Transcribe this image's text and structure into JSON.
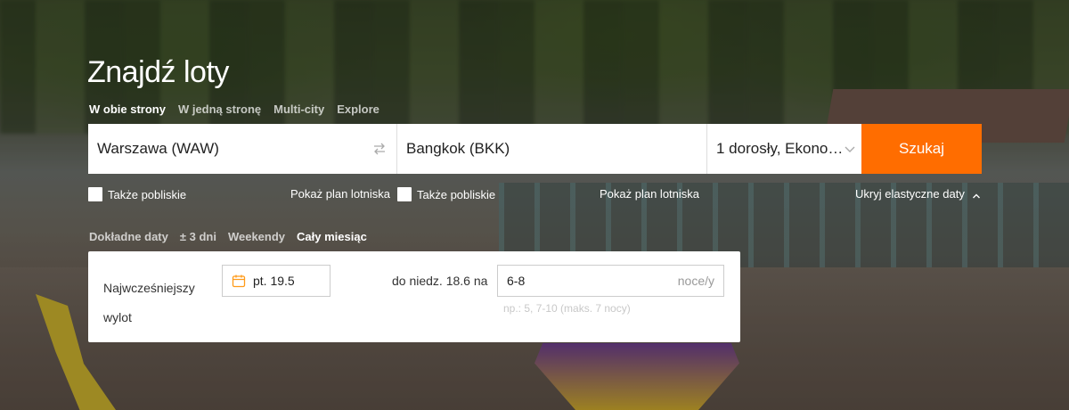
{
  "page": {
    "title": "Znajdź loty"
  },
  "trip_types": [
    "W obie strony",
    "W jedną stronę",
    "Multi-city",
    "Explore"
  ],
  "search": {
    "origin": "Warszawa (WAW)",
    "destination": "Bangkok (BKK)",
    "passengers": "1 dorosły, Ekono…",
    "button": "Szukaj"
  },
  "options": {
    "nearby_origin": "Także pobliskie",
    "airport_map_origin": "Pokaż plan lotniska",
    "nearby_dest": "Także pobliskie",
    "airport_map_dest": "Pokaż plan lotniska",
    "hide_flexible": "Ukryj elastyczne daty"
  },
  "date_modes": [
    "Dokładne daty",
    "± 3 dni",
    "Weekendy",
    "Cały miesiąc"
  ],
  "flexible": {
    "earliest_label": "Najwcześniejszy wylot",
    "earliest_value": "pt. 19.5",
    "until_label": "do niedz. 18.6 na",
    "nights_value": "6-8",
    "nights_suffix": "noce/y",
    "hint": "np.: 5, 7-10 (maks. 7 nocy)"
  },
  "colors": {
    "accent": "#ff6d00"
  },
  "icons": {
    "swap": "swap-icon",
    "chevron": "chevron-down-icon",
    "calendar": "calendar-icon"
  }
}
